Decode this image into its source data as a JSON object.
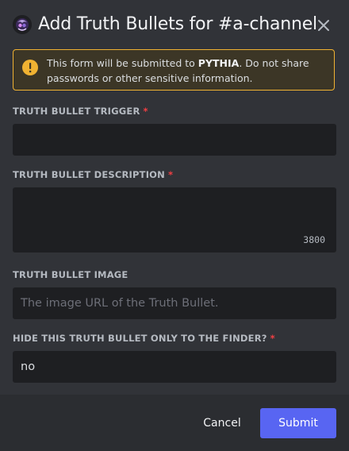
{
  "modal": {
    "title": "Add Truth Bullets for #a-channel",
    "app_icon": "bot-avatar-icon",
    "close_icon": "close-icon"
  },
  "warning": {
    "icon": "warning-icon",
    "text_before": "This form will be submitted to ",
    "app_name": "PYTHIA",
    "text_after": ". Do not share passwords or other sensitive information."
  },
  "fields": {
    "trigger": {
      "label": "TRUTH BULLET TRIGGER",
      "required_mark": "*",
      "value": ""
    },
    "description": {
      "label": "TRUTH BULLET DESCRIPTION",
      "required_mark": "*",
      "value": "",
      "char_counter": "3800"
    },
    "image": {
      "label": "TRUTH BULLET IMAGE",
      "placeholder": "The image URL of the Truth Bullet.",
      "value": ""
    },
    "hide": {
      "label": "HIDE THIS TRUTH BULLET ONLY TO THE FINDER?",
      "required_mark": "*",
      "value": "no"
    }
  },
  "footer": {
    "cancel_label": "Cancel",
    "submit_label": "Submit"
  },
  "colors": {
    "background": "#313338",
    "footer": "#2b2d31",
    "input": "#1e1f22",
    "warning_border": "#f0b232",
    "required": "#f23f43",
    "submit": "#5865f2"
  }
}
